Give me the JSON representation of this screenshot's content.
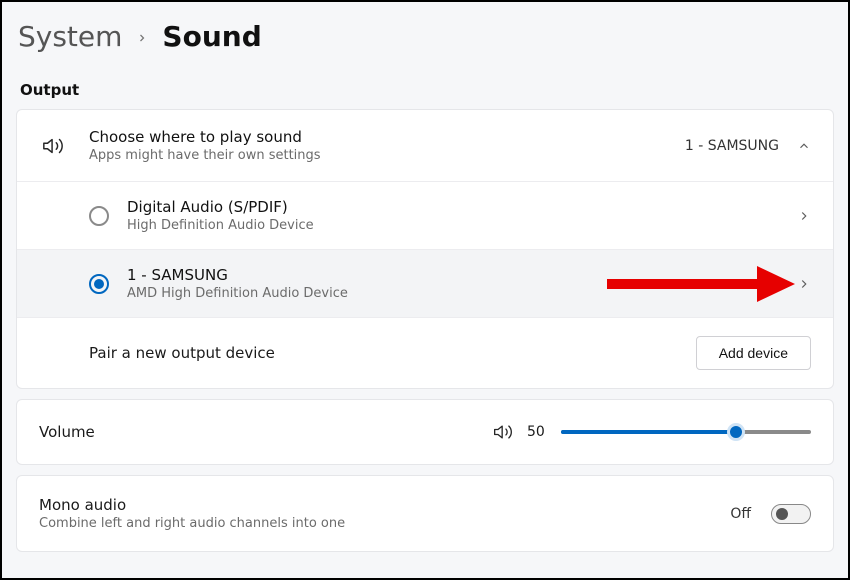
{
  "breadcrumb": {
    "parent": "System",
    "current": "Sound"
  },
  "section": {
    "output_label": "Output"
  },
  "output_selector": {
    "title": "Choose where to play sound",
    "subtitle": "Apps might have their own settings",
    "current": "1 - SAMSUNG",
    "options": [
      {
        "title": "Digital Audio (S/PDIF)",
        "sub": "High Definition Audio Device",
        "selected": false
      },
      {
        "title": "1 - SAMSUNG",
        "sub": "AMD High Definition Audio Device",
        "selected": true
      }
    ],
    "pair_label": "Pair a new output device",
    "add_button": "Add device"
  },
  "volume": {
    "label": "Volume",
    "value": "50",
    "percent": 70
  },
  "mono": {
    "title": "Mono audio",
    "subtitle": "Combine left and right audio channels into one",
    "state_label": "Off",
    "state": false
  }
}
